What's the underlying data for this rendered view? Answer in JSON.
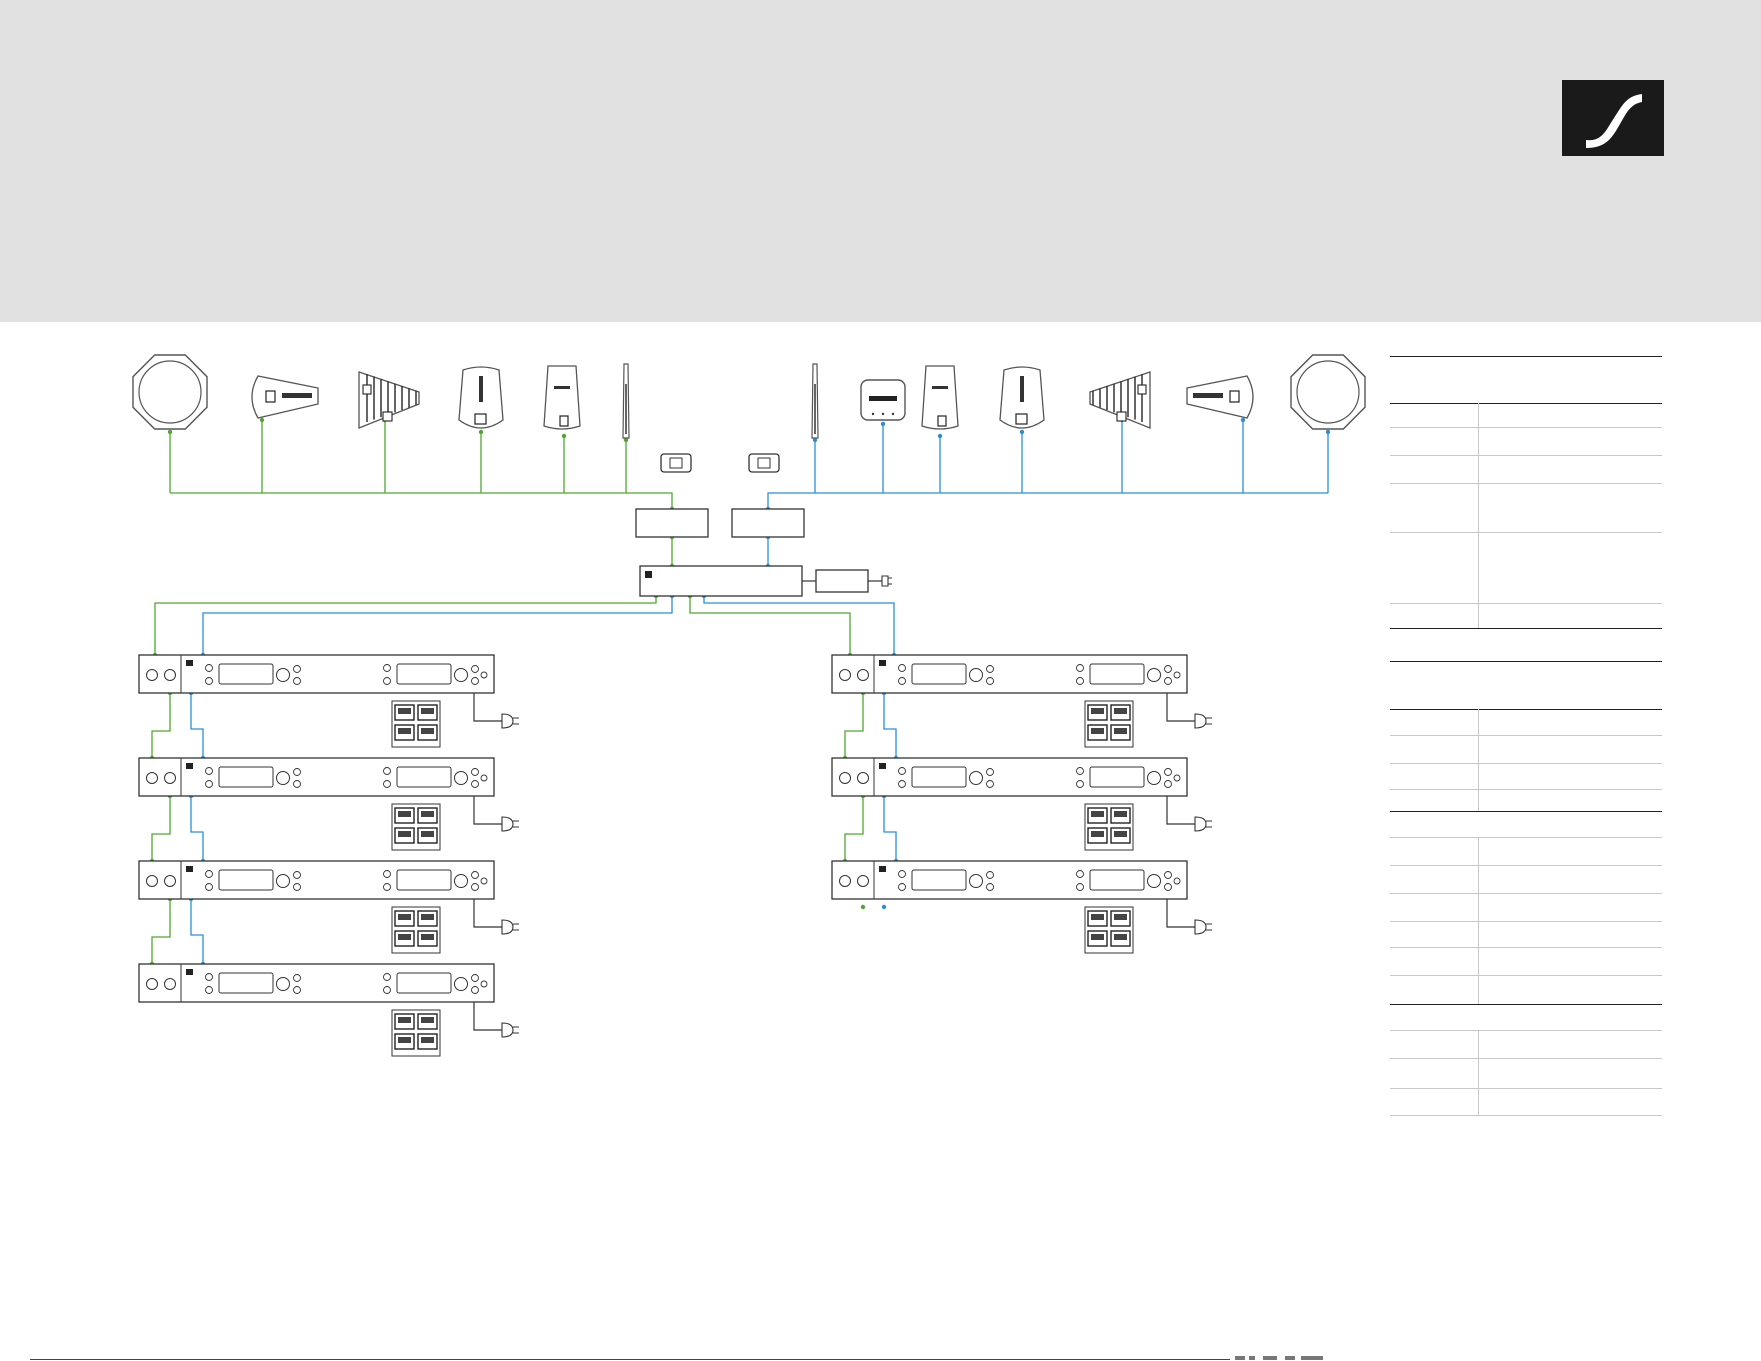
{
  "colors": {
    "header_background": "#e0e1e0",
    "green_link": "#4ea82e",
    "blue_link": "#2a8fd6",
    "device_outline": "#555555",
    "logo_background": "#1a1a1a"
  },
  "header": {
    "logo_icon": "sennheiser-logo-icon"
  },
  "diagram": {
    "left_antennas": [
      "dome-antenna",
      "directional-antenna",
      "log-periodic-antenna",
      "active-antenna",
      "wall-antenna",
      "rod-antenna"
    ],
    "right_antennas": [
      "rod-antenna",
      "wall-box-antenna",
      "wall-antenna",
      "active-antenna",
      "log-periodic-antenna",
      "directional-antenna",
      "dome-antenna"
    ],
    "left_receiver_count": 4,
    "right_receiver_count": 3
  },
  "spec_table": {
    "rows": []
  }
}
